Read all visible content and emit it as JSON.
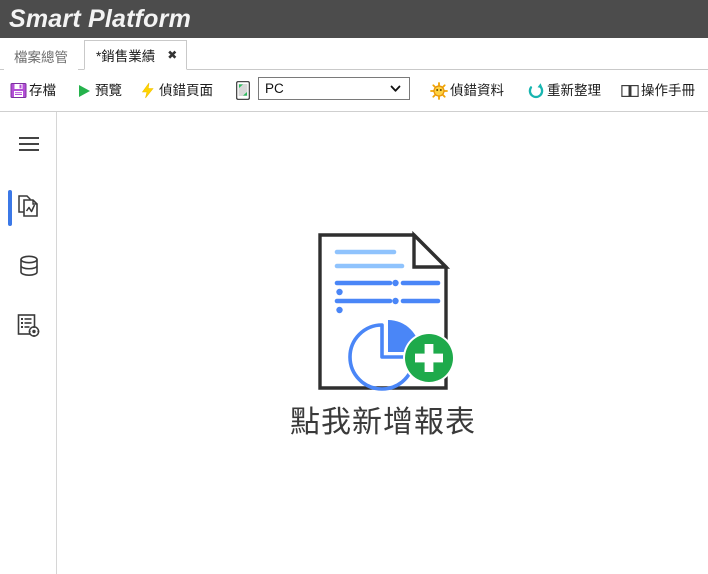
{
  "header": {
    "title": "Smart Platform",
    "bg_color": "#4c4c4c"
  },
  "tabs": [
    {
      "label": "檔案總管",
      "active": false,
      "closable": false
    },
    {
      "label": "*銷售業績",
      "active": true,
      "closable": true,
      "close_glyph": "✖"
    }
  ],
  "toolbar": {
    "save_label": "存檔",
    "save_icon": "floppy-disk-icon",
    "preview_label": "預覽",
    "preview_icon": "play-triangle-icon",
    "debug_page_label": "偵錯頁面",
    "debug_page_icon": "lightning-bolt-icon",
    "device_icon": "mobile-device-icon",
    "device_value": "PC",
    "device_options": [
      "PC"
    ],
    "debug_data_label": "偵錯資料",
    "debug_data_icon": "bug-icon",
    "refresh_label": "重新整理",
    "refresh_icon": "refresh-circle-icon",
    "manual_label": "操作手冊",
    "manual_icon": "open-book-icon"
  },
  "sidebar": {
    "items": [
      {
        "name": "menu",
        "icon": "hamburger-menu-icon",
        "active": false
      },
      {
        "name": "report-page",
        "icon": "report-page-icon",
        "active": true
      },
      {
        "name": "database",
        "icon": "database-icon",
        "active": false
      },
      {
        "name": "report-settings",
        "icon": "report-settings-icon",
        "active": false
      }
    ],
    "active_indicator_color": "#3b78e7"
  },
  "main": {
    "empty_state_label": "點我新增報表",
    "empty_state_icon": "new-report-document-icon",
    "accent_blue": "#4a86f7",
    "accent_light_blue": "#8fc3fd",
    "accent_green": "#1eaa4b"
  }
}
